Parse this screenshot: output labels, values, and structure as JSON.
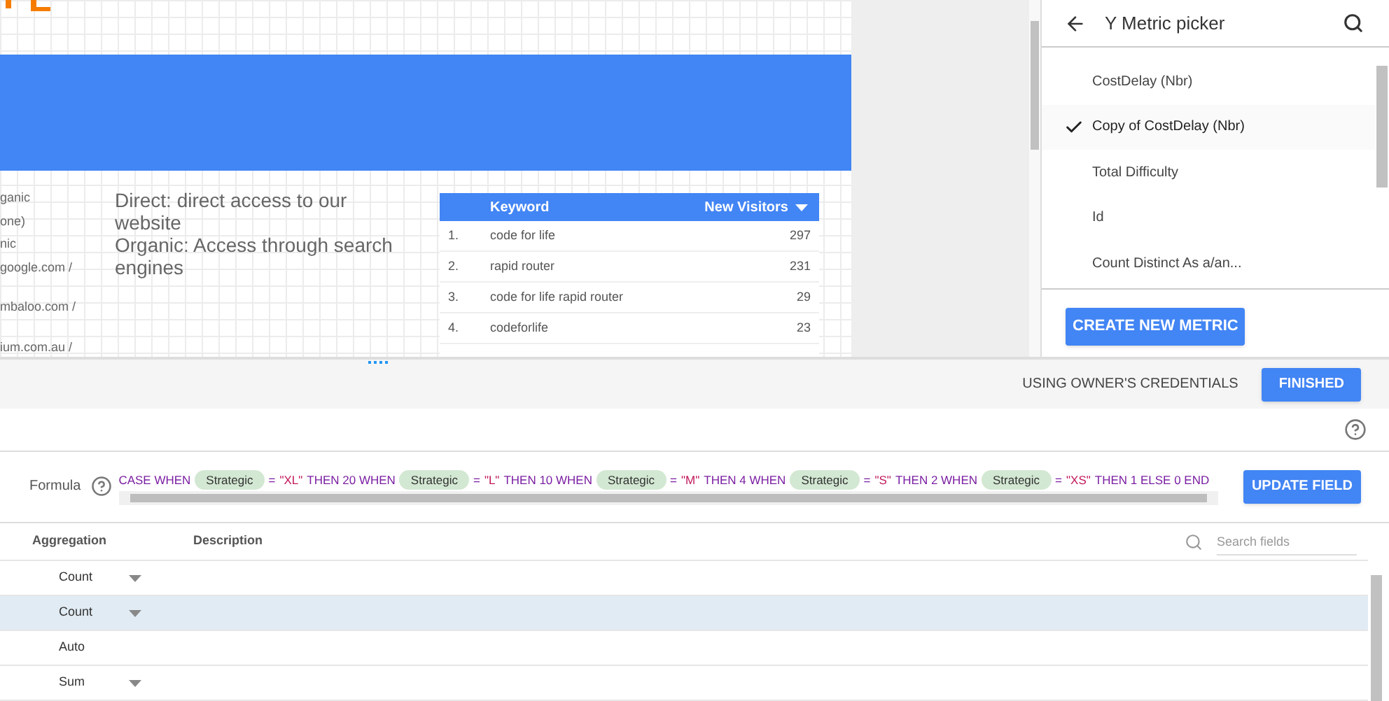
{
  "canvas": {
    "side_labels": [
      "ganic",
      "one)",
      "nic",
      "google.com /",
      "mbaloo.com /",
      "ium.com.au /"
    ],
    "description": [
      "Direct: direct access to our website",
      "Organic: Access through search engines"
    ],
    "table": {
      "columns": [
        "Keyword",
        "New Visitors"
      ],
      "sort_desc": true,
      "rows": [
        {
          "rank": "1.",
          "keyword": "code for life",
          "visitors": "297"
        },
        {
          "rank": "2.",
          "keyword": "rapid router",
          "visitors": "231"
        },
        {
          "rank": "3.",
          "keyword": "code for life rapid router",
          "visitors": "29"
        },
        {
          "rank": "4.",
          "keyword": "codeforlife",
          "visitors": "23"
        }
      ]
    }
  },
  "metric_picker": {
    "title": "Y Metric picker",
    "items": [
      {
        "label": "CostDelay (Nbr)",
        "selected": false
      },
      {
        "label": "Copy of CostDelay (Nbr)",
        "selected": true
      },
      {
        "label": "Total Difficulty",
        "selected": false
      },
      {
        "label": "Id",
        "selected": false
      },
      {
        "label": "Count Distinct As a/an...",
        "selected": false
      }
    ],
    "create_button": "CREATE NEW METRIC"
  },
  "toolbar": {
    "credentials": "USING OWNER'S CREDENTIALS",
    "finished_button": "FINISHED"
  },
  "formula": {
    "label": "Formula",
    "update_button": "UPDATE FIELD",
    "tokens": [
      {
        "kind": "keyword",
        "text": "CASE WHEN"
      },
      {
        "kind": "field",
        "text": "Strategic"
      },
      {
        "kind": "keyword",
        "text": "="
      },
      {
        "kind": "string",
        "text": "\"XL\""
      },
      {
        "kind": "keyword",
        "text": "THEN 20 WHEN"
      },
      {
        "kind": "field",
        "text": "Strategic"
      },
      {
        "kind": "keyword",
        "text": "="
      },
      {
        "kind": "string",
        "text": "\"L\""
      },
      {
        "kind": "keyword",
        "text": "THEN 10 WHEN"
      },
      {
        "kind": "field",
        "text": "Strategic"
      },
      {
        "kind": "keyword",
        "text": "="
      },
      {
        "kind": "string",
        "text": "\"M\""
      },
      {
        "kind": "keyword",
        "text": "THEN 4 WHEN"
      },
      {
        "kind": "field",
        "text": "Strategic"
      },
      {
        "kind": "keyword",
        "text": "="
      },
      {
        "kind": "string",
        "text": "\"S\""
      },
      {
        "kind": "keyword",
        "text": "THEN 2 WHEN"
      },
      {
        "kind": "field",
        "text": "Strategic"
      },
      {
        "kind": "keyword",
        "text": "="
      },
      {
        "kind": "string",
        "text": "\"XS\""
      },
      {
        "kind": "keyword",
        "text": "THEN 1 ELSE 0 END"
      }
    ]
  },
  "fields": {
    "columns": [
      "Aggregation",
      "Description"
    ],
    "search": {
      "placeholder": "Search fields"
    },
    "rows": [
      {
        "aggregation": "Count",
        "dropdown": true,
        "selected": false
      },
      {
        "aggregation": "Count",
        "dropdown": true,
        "selected": true
      },
      {
        "aggregation": "Auto",
        "dropdown": false,
        "selected": false
      },
      {
        "aggregation": "Sum",
        "dropdown": true,
        "selected": false
      }
    ]
  }
}
